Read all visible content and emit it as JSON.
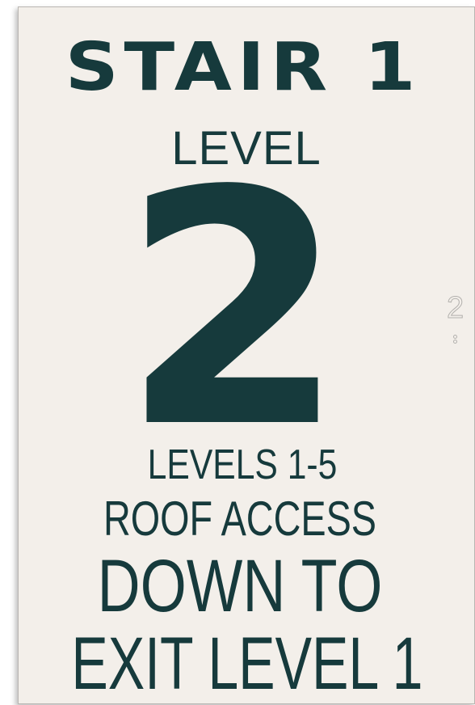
{
  "sign": {
    "stair": "STAIR 1",
    "level_word": "LEVEL",
    "level_number": "2",
    "levels_range": "LEVELS 1-5",
    "roof": "ROOF ACCESS",
    "down": "DOWN TO",
    "exit": "EXIT LEVEL 1"
  },
  "side": {
    "page_number": "2"
  },
  "colors": {
    "sign_background": "#f3efea",
    "sign_text": "#163a3c"
  }
}
